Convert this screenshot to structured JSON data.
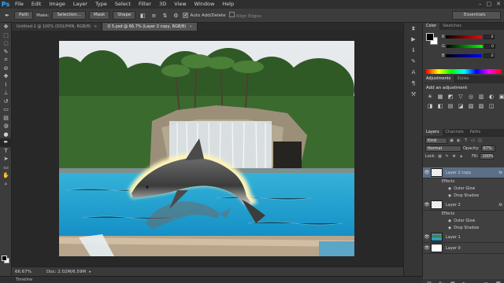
{
  "app": {
    "logo": "Ps"
  },
  "menu": [
    "File",
    "Edit",
    "Image",
    "Layer",
    "Type",
    "Select",
    "Filter",
    "3D",
    "View",
    "Window",
    "Help"
  ],
  "window_controls": [
    "–",
    "□",
    "✕"
  ],
  "options_bar": {
    "tool_mode": "Path",
    "make_label": "Make:",
    "selection_button": "Selection...",
    "mask_button": "Mask",
    "shape_button": "Shape",
    "auto_add_delete": "Auto Add/Delete",
    "align_edges": "Align Edges",
    "workspace": "Essentials"
  },
  "doc_tabs": [
    {
      "label": "Untitled-1 @ 100% (DOLPHIN, RGB/8)",
      "close": "×"
    },
    {
      "label": "Q 5.psd @ 66.7% (Layer 2 copy, RGB/8)",
      "close": "×"
    }
  ],
  "status": {
    "zoom": "66.67%",
    "doc": "Doc: 2.02M/6.59M",
    "arrow": "▸"
  },
  "timeline_label": "Timeline",
  "panels": {
    "color_tab": "Color",
    "swatches_tab": "Swatches",
    "channels": [
      {
        "label": "R",
        "value": "0",
        "gradient": "linear-gradient(90deg,#000,#ff0000)"
      },
      {
        "label": "G",
        "value": "0",
        "gradient": "linear-gradient(90deg,#000,#00ff00)"
      },
      {
        "label": "B",
        "value": "0",
        "gradient": "linear-gradient(90deg,#000,#0000ff)"
      }
    ],
    "adjustments_tab": "Adjustments",
    "styles_tab": "Styles",
    "adjustments_title": "Add an adjustment",
    "adj_icons": [
      "☀",
      "▦",
      "◩",
      "▽",
      "◎",
      "▥",
      "◐",
      "▣",
      "◨",
      "◧",
      "▤",
      "◪",
      "▧",
      "▨",
      "◫"
    ],
    "layers_tab": "Layers",
    "channels_tab": "Channels",
    "paths_tab": "Paths",
    "filter_kind": "Kind",
    "blend_mode": "Normal",
    "opacity_label": "Opacity:",
    "opacity_value": "67%",
    "lock_label": "Lock:",
    "fill_label": "Fill:",
    "fill_value": "100%",
    "layers": [
      {
        "name": "Layer 2 copy",
        "fx": "fx",
        "effects_label": "Effects",
        "effects": [
          "Outer Glow",
          "Drop Shadow"
        ],
        "selected": true
      },
      {
        "name": "Layer 2",
        "fx": "fx",
        "effects_label": "Effects",
        "effects": [
          "Outer Glow",
          "Drop Shadow"
        ],
        "selected": false
      },
      {
        "name": "Layer 1"
      },
      {
        "name": "Layer 0"
      }
    ]
  }
}
